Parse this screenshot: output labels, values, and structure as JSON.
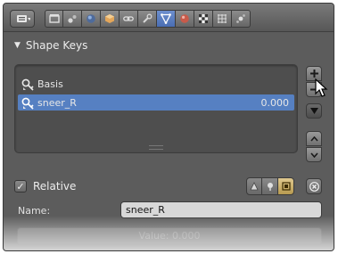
{
  "toolbar": {
    "editor_menu_icon": "properties-editor-icon",
    "tabs": [
      {
        "icon": "render-icon"
      },
      {
        "icon": "scene-icon"
      },
      {
        "icon": "world-icon"
      },
      {
        "icon": "object-icon"
      },
      {
        "icon": "constraints-icon"
      },
      {
        "icon": "modifiers-icon"
      },
      {
        "icon": "object-data-icon",
        "active": true
      },
      {
        "icon": "material-icon"
      },
      {
        "icon": "texture-icon"
      },
      {
        "icon": "particles-icon"
      },
      {
        "icon": "physics-icon"
      }
    ],
    "active_color": "#5680c2"
  },
  "panel": {
    "title": "Shape Keys"
  },
  "shape_keys": {
    "items": [
      {
        "name": "Basis",
        "value": ""
      },
      {
        "name": "sneer_R",
        "value": "0.000",
        "selected": true
      }
    ],
    "selected_color": "#5680c2"
  },
  "relative": {
    "label": "Relative",
    "checked": true,
    "check_mark": "✓"
  },
  "name_field": {
    "label": "Name:",
    "value": "sneer_R"
  },
  "value_slider": {
    "text": "Value: 0.000"
  }
}
